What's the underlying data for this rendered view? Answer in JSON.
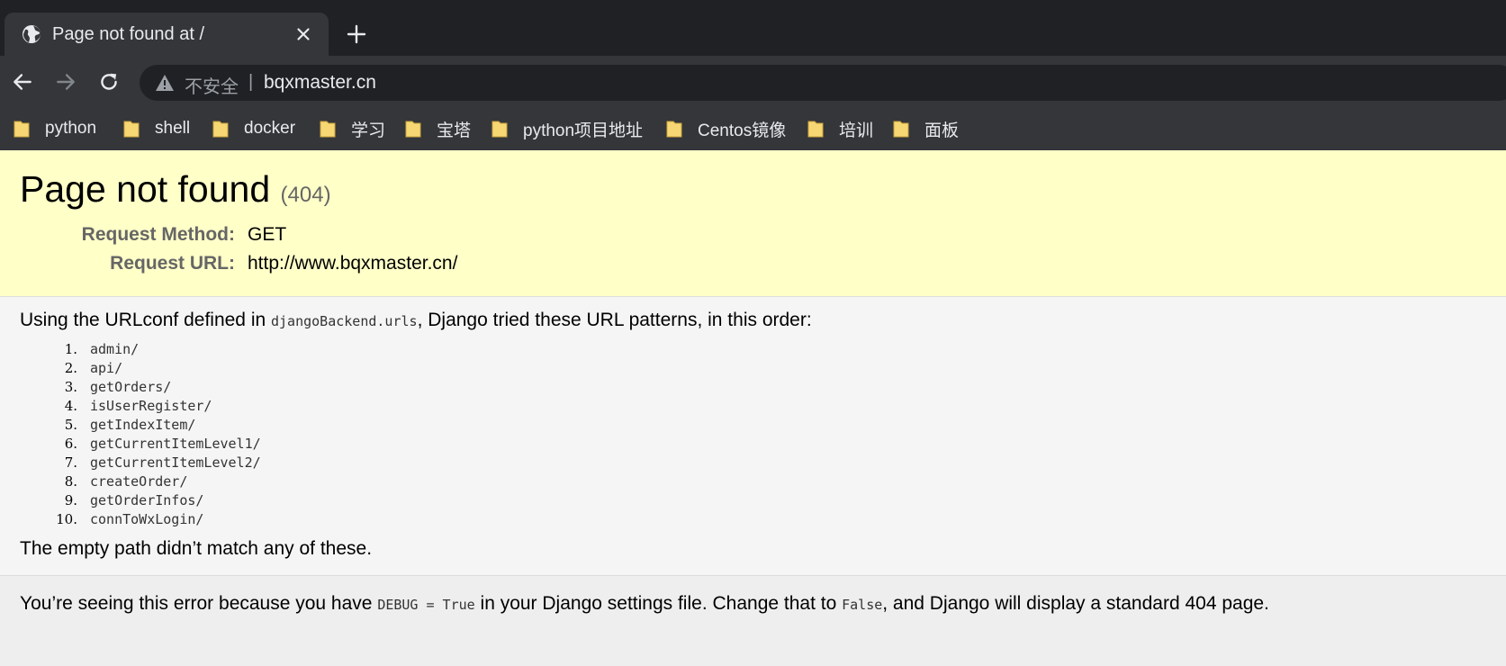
{
  "browser": {
    "tab": {
      "title": "Page not found at /"
    },
    "address_bar": {
      "security_label": "不安全",
      "separator": "|",
      "url": "bqxmaster.cn"
    },
    "bookmarks": [
      "python",
      "shell",
      "docker",
      "学习",
      "宝塔",
      "python项目地址",
      "Centos镜像",
      "培训",
      "面板"
    ],
    "colors": {
      "tabstrip": "#202124",
      "toolbar": "#35363a",
      "bookmark_folder": "#f7d774"
    }
  },
  "page": {
    "title": "Page not found",
    "status_code": "(404)",
    "request": [
      {
        "label": "Request Method:",
        "value": "GET"
      },
      {
        "label": "Request URL:",
        "value": "http://www.bqxmaster.cn/"
      }
    ],
    "intro": {
      "before": "Using the URLconf defined in ",
      "urlconf": "djangoBackend.urls",
      "after": ", Django tried these URL patterns, in this order:"
    },
    "patterns": [
      "admin/",
      "api/",
      "getOrders/",
      "isUserRegister/",
      "getIndexItem/",
      "getCurrentItemLevel1/",
      "getCurrentItemLevel2/",
      "createOrder/",
      "getOrderInfos/",
      "connToWxLogin/"
    ],
    "empty_path_message": "The empty path didn’t match any of these.",
    "explanation": {
      "part1": "You’re seeing this error because you have ",
      "code1": "DEBUG = True",
      "part2": " in your Django settings file. Change that to ",
      "code2": "False",
      "part3": ", and Django will display a standard 404 page."
    },
    "colors": {
      "summary_bg": "#ffffc8",
      "info_bg": "#f5f5f5",
      "explanation_bg": "#eeeeee"
    }
  }
}
